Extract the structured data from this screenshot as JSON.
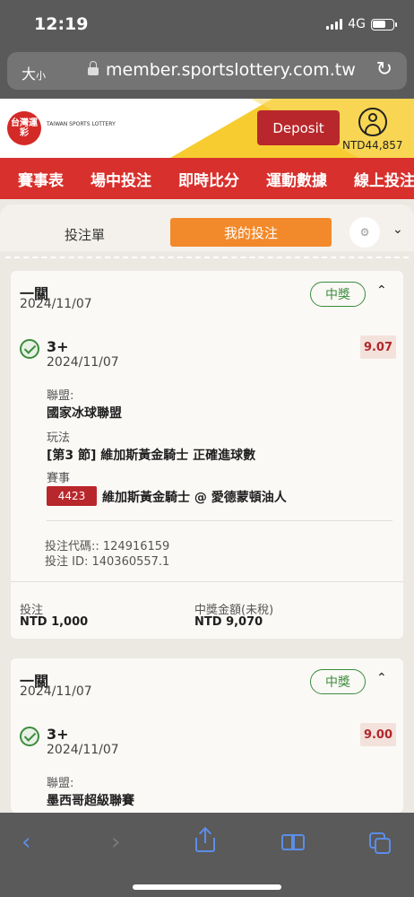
{
  "status": {
    "time": "12:19",
    "network": "4G",
    "battery_level": 0.65
  },
  "browser": {
    "text_size_label": "大",
    "text_size_small": "小",
    "url": "member.sportslottery.com.tw"
  },
  "header": {
    "logo_text": "台灣運彩",
    "logo_subtitle": "TAIWAN SPORTS LOTTERY",
    "deposit_label": "Deposit",
    "balance": "NTD44,857"
  },
  "nav": {
    "items": [
      "賽事表",
      "場中投注",
      "即時比分",
      "運動數據",
      "線上投注"
    ]
  },
  "tabs": {
    "betslip": "投注單",
    "my_bets": "我的投注"
  },
  "bets": [
    {
      "type": "一關",
      "date": "2024/11/07",
      "status": "中獎",
      "selection": "3+",
      "selection_date": "2024/11/07",
      "odds": "9.07",
      "league_label": "聯盟:",
      "league": "國家冰球聯盟",
      "market_label": "玩法",
      "market": "[第3 節] 維加斯黃金騎士 正確進球數",
      "event_label": "賽事",
      "event_id": "4423",
      "event_name": "維加斯黃金騎士 @ 愛德蒙頓油人",
      "bet_code": "投注代碼:: 124916159",
      "bet_id": "投注 ID: 140360557.1",
      "stake_label": "投注",
      "stake": "NTD 1,000",
      "payout_label": "中獎金額(未稅)",
      "payout": "NTD 9,070"
    },
    {
      "type": "一關",
      "date": "2024/11/07",
      "status": "中獎",
      "selection": "3+",
      "selection_date": "2024/11/07",
      "odds": "9.00",
      "league_label": "聯盟:",
      "league": "墨西哥超級聯賽"
    }
  ]
}
